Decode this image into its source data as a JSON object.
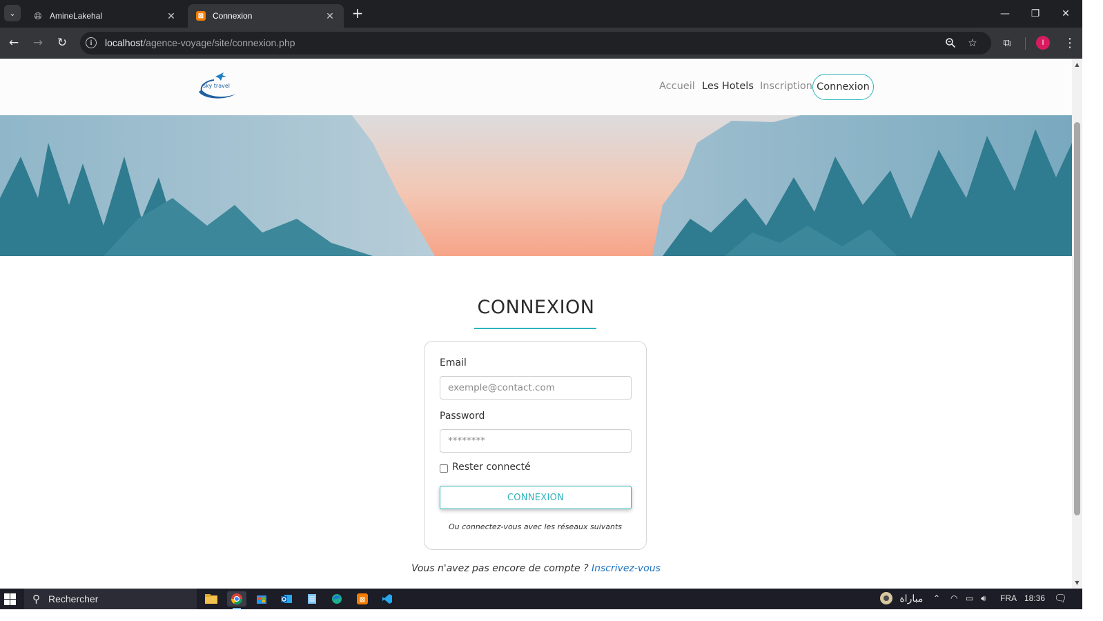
{
  "browser": {
    "tabs": [
      {
        "title": "AmineLakehal",
        "icon": "globe-icon"
      },
      {
        "title": "Connexion",
        "icon": "xampp-icon"
      }
    ],
    "url_host": "localhost",
    "url_path": "/agence-voyage/site/connexion.php",
    "profile_initial": "I"
  },
  "site": {
    "logo_text": "sky travel",
    "nav": {
      "accueil": "Accueil",
      "hotels": "Les Hotels",
      "inscription": "Inscription",
      "connexion": "Connexion"
    }
  },
  "login": {
    "title": "CONNEXION",
    "email_label": "Email",
    "email_placeholder": "exemple@contact.com",
    "password_label": "Password",
    "password_placeholder": "********",
    "remember_label": "Rester connecté",
    "remember_checked": false,
    "submit_label": "CONNEXION",
    "social_text": "Ou connectez-vous avec les réseaux suivants"
  },
  "signup": {
    "prompt": "Vous n'avez pas encore de compte ? ",
    "link": "Inscrivez-vous"
  },
  "taskbar": {
    "search_placeholder": "Rechercher",
    "news_label": "مباراة",
    "lang": "FRA",
    "time": "18:36"
  },
  "colors": {
    "accent": "#2bb3bd",
    "link": "#1e73be",
    "chrome_dark": "#35363a"
  }
}
